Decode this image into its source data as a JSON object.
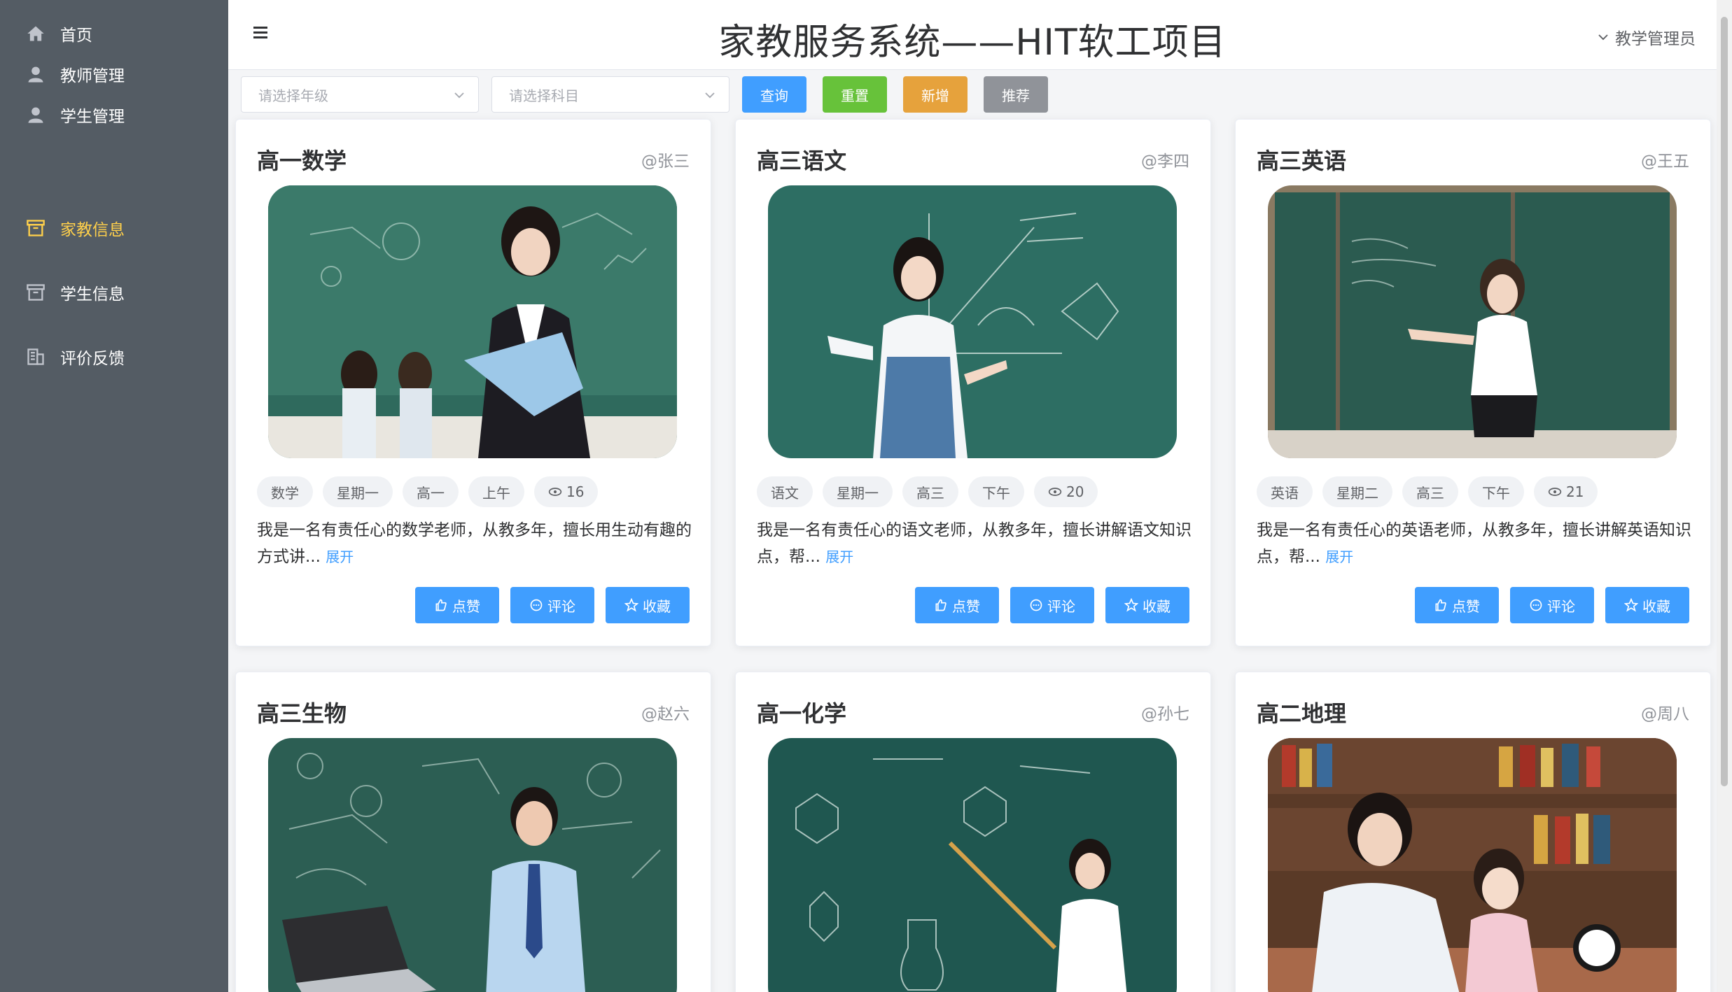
{
  "sidebar": {
    "items": [
      {
        "label": "首页",
        "icon": "home-icon"
      },
      {
        "label": "教师管理",
        "icon": "user-icon"
      },
      {
        "label": "学生管理",
        "icon": "user-icon"
      },
      {
        "label": "家教信息",
        "icon": "box-icon",
        "active": true
      },
      {
        "label": "学生信息",
        "icon": "box-icon"
      },
      {
        "label": "评价反馈",
        "icon": "office-building-icon"
      }
    ]
  },
  "header": {
    "title": "家教服务系统——HIT软工项目",
    "user": "教学管理员"
  },
  "toolbar": {
    "grade_placeholder": "请选择年级",
    "subject_placeholder": "请选择科目",
    "query_label": "查询",
    "reset_label": "重置",
    "add_label": "新增",
    "recommend_label": "推荐"
  },
  "colors": {
    "sidebar_bg": "#545c64",
    "active_nav": "#ffd04b",
    "primary": "#409eff",
    "success": "#67c23a",
    "warning": "#e6a23c",
    "info": "#909399"
  },
  "cards": [
    {
      "title": "高一数学",
      "author": "@张三",
      "tags": [
        "数学",
        "星期一",
        "高一",
        "上午"
      ],
      "views": "16",
      "desc": "我是一名有责任心的数学老师，从教多年，擅长用生动有趣的方式讲...",
      "expand": "展开",
      "image": "teacher-math-photo"
    },
    {
      "title": "高三语文",
      "author": "@李四",
      "tags": [
        "语文",
        "星期一",
        "高三",
        "下午"
      ],
      "views": "20",
      "desc": "我是一名有责任心的语文老师，从教多年，擅长讲解语文知识点，帮...",
      "expand": "展开",
      "image": "teacher-chinese-photo"
    },
    {
      "title": "高三英语",
      "author": "@王五",
      "tags": [
        "英语",
        "星期二",
        "高三",
        "下午"
      ],
      "views": "21",
      "desc": "我是一名有责任心的英语老师，从教多年，擅长讲解英语知识点，帮...",
      "expand": "展开",
      "image": "teacher-english-photo"
    },
    {
      "title": "高三生物",
      "author": "@赵六",
      "image": "teacher-biology-photo"
    },
    {
      "title": "高一化学",
      "author": "@孙七",
      "image": "teacher-chemistry-photo"
    },
    {
      "title": "高二地理",
      "author": "@周八",
      "image": "teacher-geography-photo"
    }
  ],
  "actions": {
    "like": "点赞",
    "comment": "评论",
    "favorite": "收藏"
  }
}
